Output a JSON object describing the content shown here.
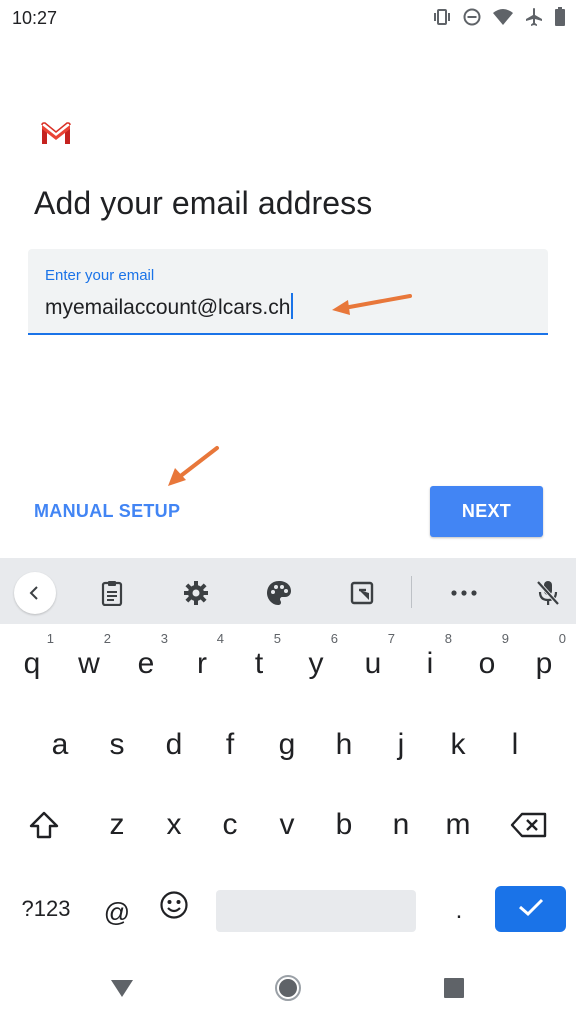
{
  "status_bar": {
    "time": "10:27",
    "icons": [
      "vibrate-icon",
      "do-not-disturb-icon",
      "wifi-icon",
      "airplane-icon",
      "battery-icon"
    ]
  },
  "header": {
    "logo": "gmail-logo",
    "title": "Add your email address"
  },
  "email_field": {
    "label": "Enter your email",
    "value": "myemailaccount@lcars.ch"
  },
  "actions": {
    "manual_setup_label": "MANUAL SETUP",
    "next_label": "NEXT"
  },
  "keyboard": {
    "toolbar_icons": [
      "back-icon",
      "clipboard-icon",
      "settings-icon",
      "palette-icon",
      "resize-icon",
      "more-icon",
      "mic-off-icon"
    ],
    "row1": [
      {
        "key": "q",
        "hint": "1"
      },
      {
        "key": "w",
        "hint": "2"
      },
      {
        "key": "e",
        "hint": "3"
      },
      {
        "key": "r",
        "hint": "4"
      },
      {
        "key": "t",
        "hint": "5"
      },
      {
        "key": "y",
        "hint": "6"
      },
      {
        "key": "u",
        "hint": "7"
      },
      {
        "key": "i",
        "hint": "8"
      },
      {
        "key": "o",
        "hint": "9"
      },
      {
        "key": "p",
        "hint": "0"
      }
    ],
    "row2": [
      "a",
      "s",
      "d",
      "f",
      "g",
      "h",
      "j",
      "k",
      "l"
    ],
    "row3": [
      "z",
      "x",
      "c",
      "v",
      "b",
      "n",
      "m"
    ],
    "symbols_label": "?123",
    "at_label": "@",
    "period_label": "."
  },
  "colors": {
    "accent": "#1a73e8",
    "button": "#4285f4",
    "annotation_arrow": "#e8773a",
    "field_bg": "#f1f3f4",
    "keyboard_toolbar_bg": "#e8eaed"
  }
}
